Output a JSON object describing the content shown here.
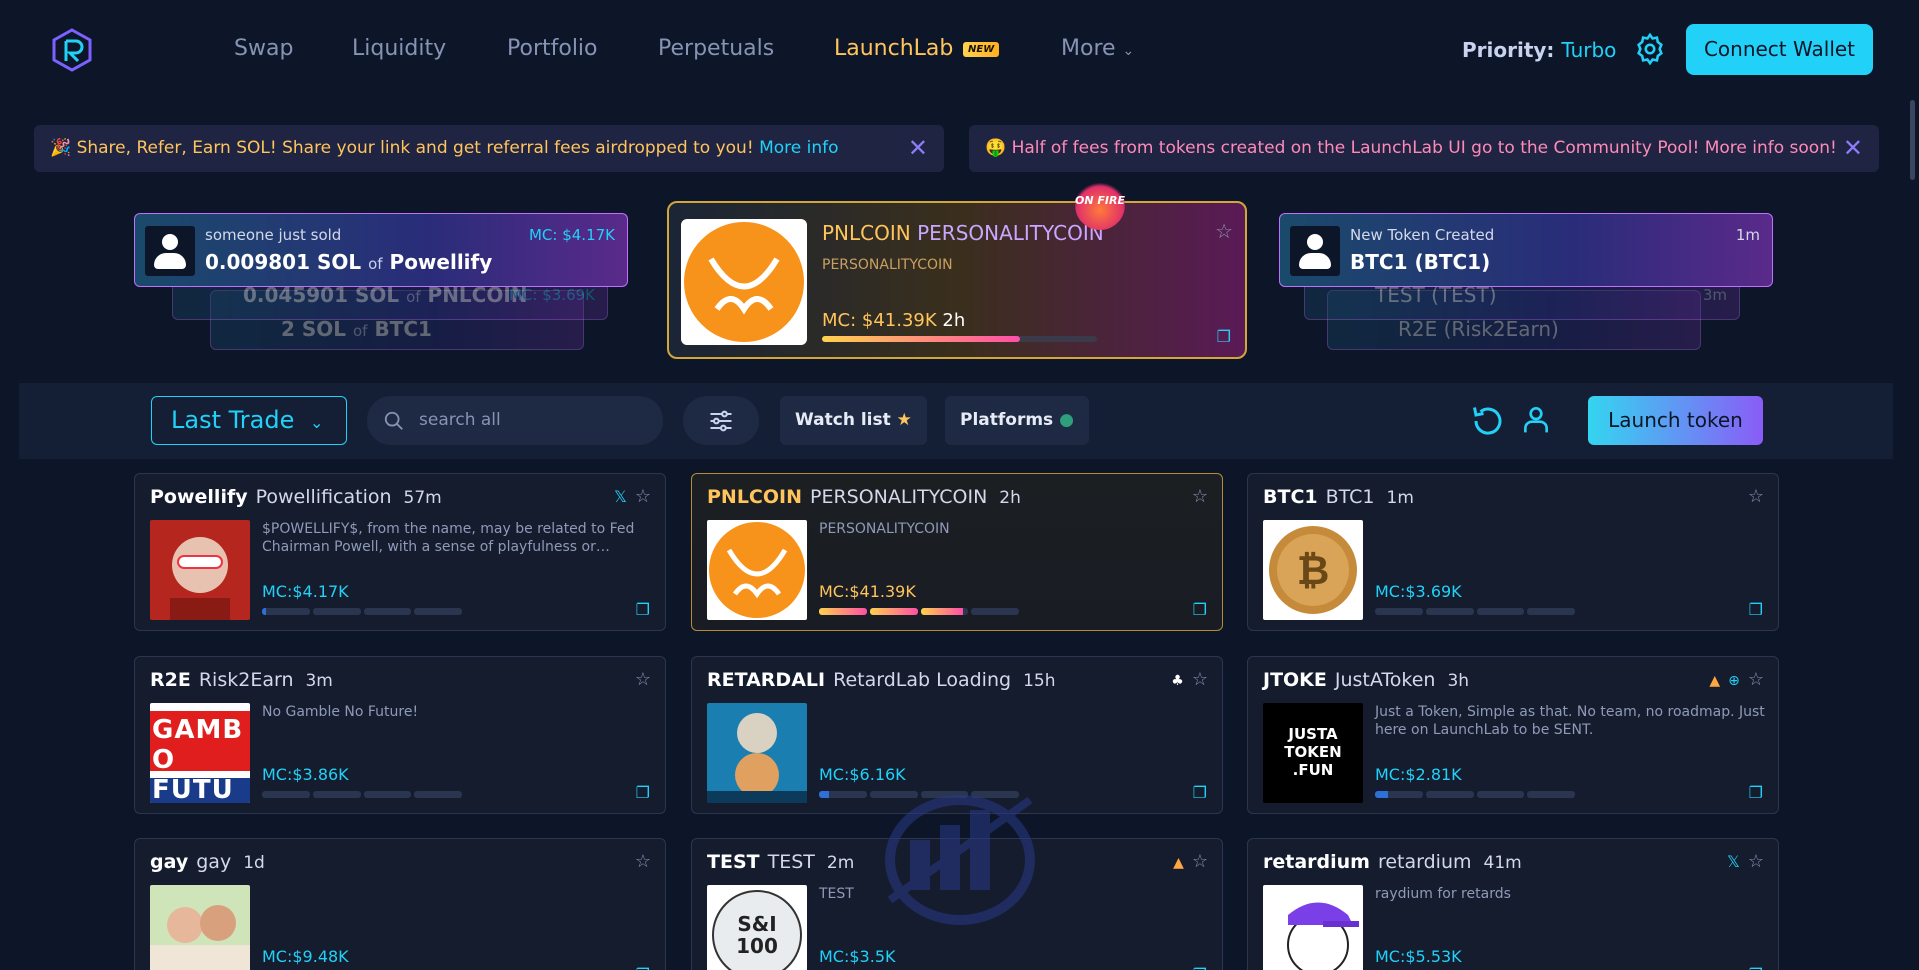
{
  "nav": {
    "items": [
      "Swap",
      "Liquidity",
      "Portfolio",
      "Perpetuals",
      "LaunchLab",
      "More"
    ],
    "new_badge": "NEW",
    "priority_label": "Priority:",
    "priority_value": "Turbo",
    "connect": "Connect Wallet"
  },
  "banners": [
    {
      "emoji": "🎉",
      "text": "Share, Refer, Earn SOL! Share your link and get referral fees airdropped to you!",
      "more": "More info"
    },
    {
      "emoji": "🤑",
      "text": "Half of fees from tokens created on the LaunchLab UI go to the Community Pool! More info soon!"
    }
  ],
  "activity_left": [
    {
      "label": "someone just sold",
      "amount": "0.009801 SOL",
      "of": "of",
      "token": "Powellify",
      "mc": "MC: $4.17K"
    },
    {
      "amount": "0.045901 SOL",
      "of": "of",
      "token": "PNLCOIN",
      "mc": "MC: $3.69K"
    },
    {
      "amount": "2 SOL",
      "of": "of",
      "token": "BTC1"
    }
  ],
  "activity_right": [
    {
      "label": "New Token Created",
      "token": "BTC1 (BTC1)",
      "age": "1m"
    },
    {
      "label": "New Token Created",
      "token": "TEST (TEST)",
      "age": "3m"
    },
    {
      "token": "R2E (Risk2Earn)"
    }
  ],
  "featured": {
    "symbol": "PNLCOIN",
    "name": "PERSONALITYCOIN",
    "sub": "PERSONALITYCOIN",
    "mc": "MC: $41.39K",
    "age": "2h",
    "progress": 0.72,
    "fire_text": "ON FIRE"
  },
  "toolbar": {
    "sort": "Last Trade",
    "search_placeholder": "search all",
    "watch": "Watch list",
    "platforms": "Platforms",
    "launch": "Launch token"
  },
  "cards": [
    {
      "sym": "Powellify",
      "name": "Powellification",
      "age": "57m",
      "desc": "$POWELLIFY$, from the name, may be related to Fed Chairman Powell, with a sense of playfulness or…",
      "mc": "MC:$4.17K",
      "progress": 0.02,
      "icons": [
        "x"
      ]
    },
    {
      "sym": "PNLCOIN",
      "name": "PERSONALITYCOIN",
      "age": "2h",
      "desc": "PERSONALITYCOIN",
      "mc": "MC:$41.39K",
      "progress": 0.72,
      "icons": [],
      "hot": true
    },
    {
      "sym": "BTC1",
      "name": "BTC1",
      "age": "1m",
      "desc": "",
      "mc": "MC:$3.69K",
      "progress": 0.0,
      "icons": []
    },
    {
      "sym": "R2E",
      "name": "Risk2Earn",
      "age": "3m",
      "desc": "No Gamble No Future!",
      "mc": "MC:$3.86K",
      "progress": 0.0,
      "icons": []
    },
    {
      "sym": "RETARDALI",
      "name": "RetardLab Loading",
      "age": "15h",
      "desc": "",
      "mc": "MC:$6.16K",
      "progress": 0.05,
      "icons": [
        "w"
      ]
    },
    {
      "sym": "JTOKE",
      "name": "JustAToken",
      "age": "3h",
      "desc": "Just a Token, Simple as that. No team, no roadmap. Just here on LaunchLab to be SENT.",
      "mc": "MC:$2.81K",
      "progress": 0.07,
      "icons": [
        "o",
        "g"
      ]
    },
    {
      "sym": "gay",
      "name": "gay",
      "age": "1d",
      "desc": "",
      "mc": "MC:$9.48K",
      "progress": 0.0,
      "icons": []
    },
    {
      "sym": "TEST",
      "name": "TEST",
      "age": "2m",
      "desc": "TEST",
      "mc": "MC:$3.5K",
      "progress": 0.0,
      "icons": [
        "o"
      ]
    },
    {
      "sym": "retardium",
      "name": "retardium",
      "age": "41m",
      "desc": "raydium for retards",
      "mc": "MC:$5.53K",
      "progress": 0.0,
      "icons": [
        "x"
      ]
    }
  ],
  "thumb_text": {
    "r2e": "GAMB O FUTU",
    "jtoke": "JUSTA TOKEN .FUN",
    "test": "S&I 100"
  },
  "colors": {
    "accent": "#22d1f8",
    "gold": "#ffc45c",
    "bg": "#0c1628",
    "purple": "#8a5cf7"
  }
}
